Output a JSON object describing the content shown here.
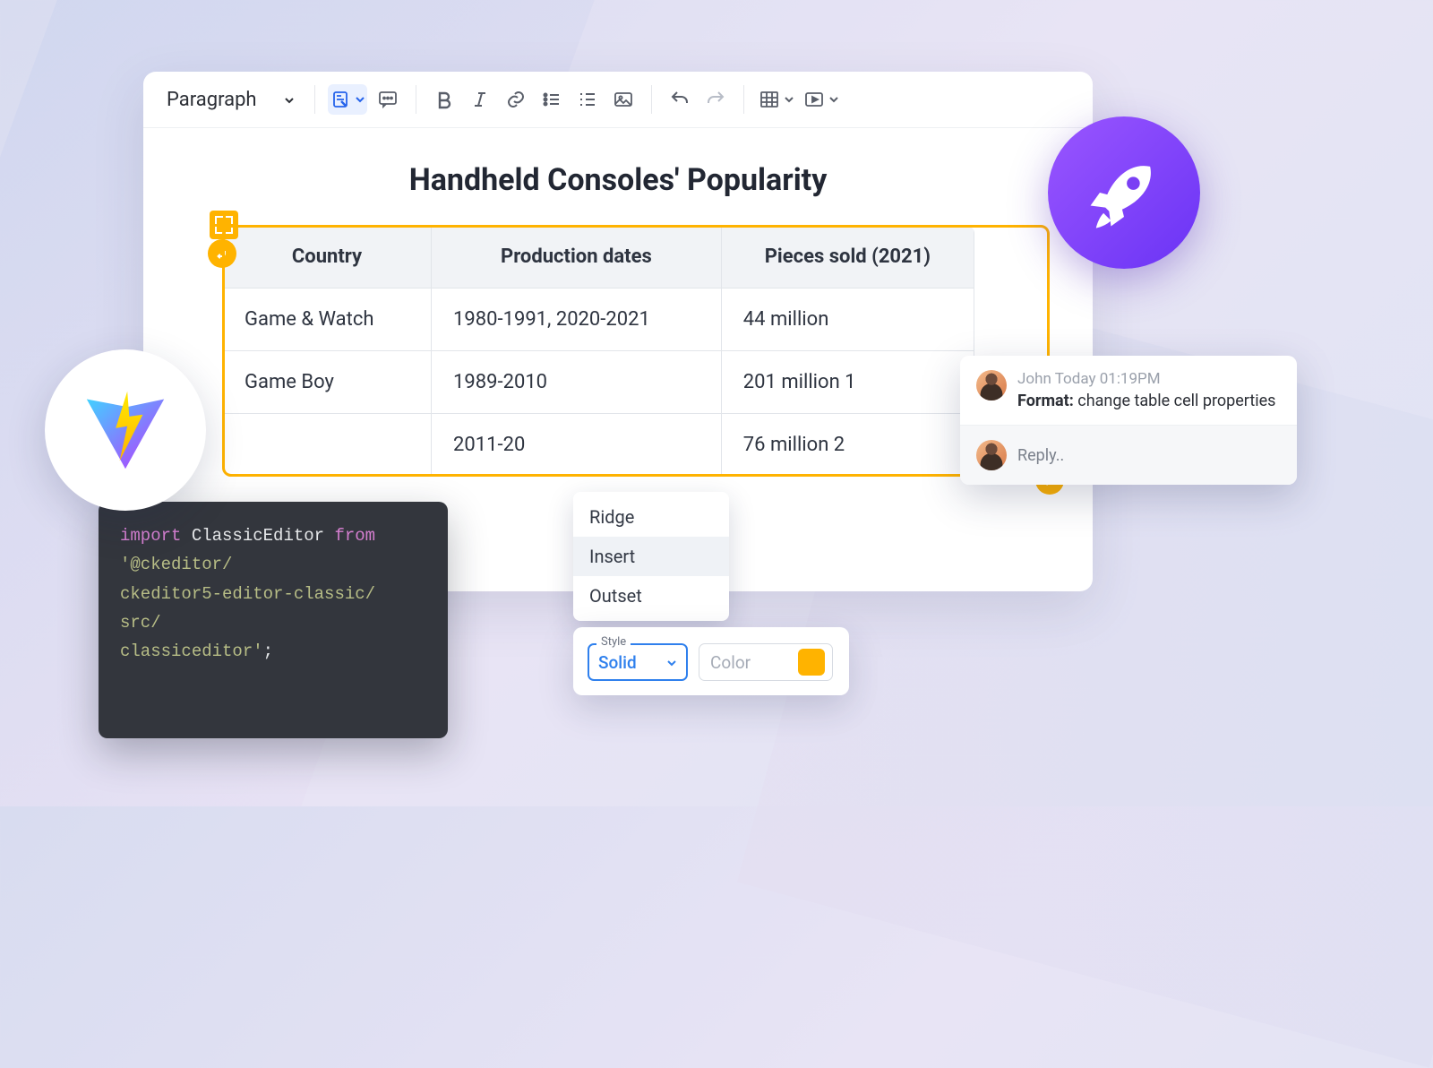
{
  "toolbar": {
    "style_select": "Paragraph"
  },
  "document": {
    "title": "Handheld Consoles' Popularity",
    "table": {
      "headers": [
        "Country",
        "Production dates",
        "Pieces sold (2021)"
      ],
      "rows": [
        [
          "Game & Watch",
          "1980-1991, 2020-2021",
          "44 million"
        ],
        [
          "Game Boy",
          "1989-2010",
          "201 million 1"
        ],
        [
          "",
          "2011-20",
          "76 million 2"
        ]
      ]
    }
  },
  "comment_badge": {
    "count": "1"
  },
  "comment": {
    "author": "John",
    "timestamp": "Today 01:19PM",
    "body_prefix": "Format:",
    "body_rest": " change table cell properties",
    "reply_placeholder": "Reply.."
  },
  "dropdown": {
    "items": [
      "Ridge",
      "Insert",
      "Outset"
    ],
    "hovered_index": 1
  },
  "properties": {
    "style_label": "Style",
    "style_value": "Solid",
    "color_label": "Color",
    "swatch_hex": "#ffb300"
  },
  "code": {
    "line1_kw1": "import",
    "line1_id": " ClassicEditor ",
    "line1_kw2": "from",
    "line2": "'@ckeditor/",
    "line3": "ckeditor5-editor-classic/",
    "line4": "src/",
    "line5_a": "classiceditor'",
    "line5_b": ";"
  }
}
